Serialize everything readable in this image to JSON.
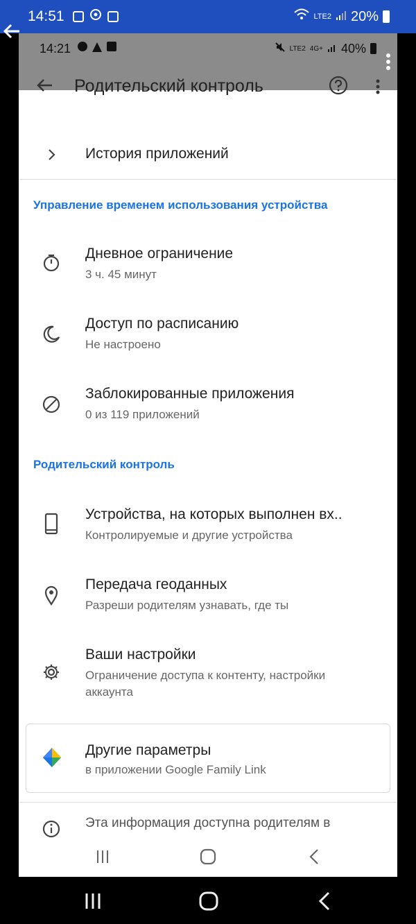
{
  "outer_status": {
    "time": "14:51",
    "battery": "20%",
    "network_label": "LTE2"
  },
  "inner_status": {
    "time": "14:21",
    "battery": "40%",
    "network_label": "LTE2",
    "network_label2": "4G+"
  },
  "toolbar": {
    "title": "Родительский контроль"
  },
  "app_history": {
    "label": "История приложений"
  },
  "section_time": {
    "title": "Управление временем использования устройства"
  },
  "daily_limit": {
    "label": "Дневное ограничение",
    "value": "3 ч. 45 минут"
  },
  "schedule": {
    "label": "Доступ по расписанию",
    "value": "Не настроено"
  },
  "blocked_apps": {
    "label": "Заблокированные приложения",
    "value": "0 из 119 приложений"
  },
  "section_parental": {
    "title": "Родительский контроль"
  },
  "devices": {
    "label": "Устройства, на которых выполнен вх..",
    "value": "Контролируемые и другие устройства"
  },
  "location": {
    "label": "Передача геоданных",
    "value": "Разреши родителям узнавать, где ты"
  },
  "settings": {
    "label": "Ваши настройки",
    "value_line1": "Ограничение доступа к контенту, настройки",
    "value_line2": "аккаунта"
  },
  "more_options": {
    "label": "Другие параметры",
    "value": "в приложении Google Family Link"
  },
  "info": {
    "text": "Эта информация доступна родителям в"
  },
  "colors": {
    "outer_status_bg": "#1f4fbf",
    "accent": "#1a73e8",
    "inner_header_bg": "#8b8b8b"
  }
}
